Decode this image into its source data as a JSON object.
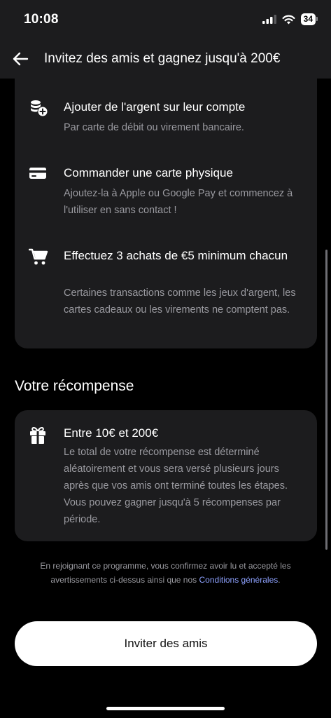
{
  "status_bar": {
    "time": "10:08",
    "battery": "34"
  },
  "header": {
    "title": "Invitez des amis et gagnez jusqu'à 200€"
  },
  "steps": [
    {
      "icon": "coins-add-icon",
      "title": "Ajouter de l'argent sur leur compte",
      "desc": "Par carte de débit ou virement bancaire."
    },
    {
      "icon": "credit-card-icon",
      "title": "Commander une carte physique",
      "desc": "Ajoutez-la à Apple ou Google Pay et commencez à l'utiliser en sans contact !"
    },
    {
      "icon": "shopping-cart-icon",
      "title": "Effectuez 3 achats de €5 minimum chacun",
      "desc": "Certaines transactions comme les jeux d'argent, les cartes cadeaux ou les virements ne comptent pas."
    }
  ],
  "reward": {
    "section_title": "Votre récompense",
    "icon": "gift-icon",
    "title": "Entre 10€ et 200€",
    "desc": "Le total de votre récompense est déterminé aléatoirement et vous sera versé plusieurs jours après que vos amis ont terminé toutes les étapes. Vous pouvez gagner jusqu'à 5 récompenses par période."
  },
  "disclaimer": {
    "text": "En rejoignant ce programme, vous confirmez avoir lu et accepté les avertissements ci-dessus ainsi que nos ",
    "link": "Conditions générales",
    "suffix": "."
  },
  "cta": {
    "label": "Inviter des amis"
  }
}
